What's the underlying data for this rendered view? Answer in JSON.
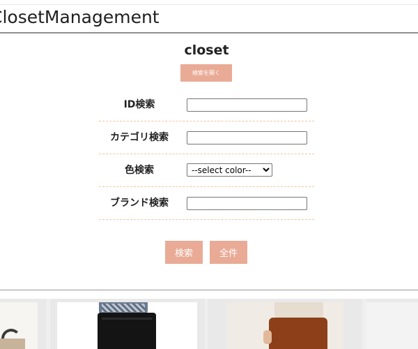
{
  "header": {
    "app_title": "ClosetManagement"
  },
  "main": {
    "page_title": "closet",
    "toggle_search_label": "検索を開く"
  },
  "search_form": {
    "fields": [
      {
        "label": "ID検索",
        "type": "text",
        "value": ""
      },
      {
        "label": "カテゴリ検索",
        "type": "text",
        "value": ""
      },
      {
        "label": "色検索",
        "type": "select",
        "selected": "--select color--"
      },
      {
        "label": "ブランド検索",
        "type": "text",
        "value": ""
      }
    ],
    "search_button_label": "検索",
    "all_button_label": "全件"
  },
  "colors": {
    "accent": "#e9ab96",
    "row_divider": "#f1c59e",
    "header_rule": "#8f8f8f"
  },
  "grid": {
    "items": [
      {
        "image": "bag-photo"
      },
      {
        "image": "black-pants-photo"
      },
      {
        "image": "brown-skirt-photo"
      },
      {
        "image": "item-photo"
      }
    ]
  }
}
